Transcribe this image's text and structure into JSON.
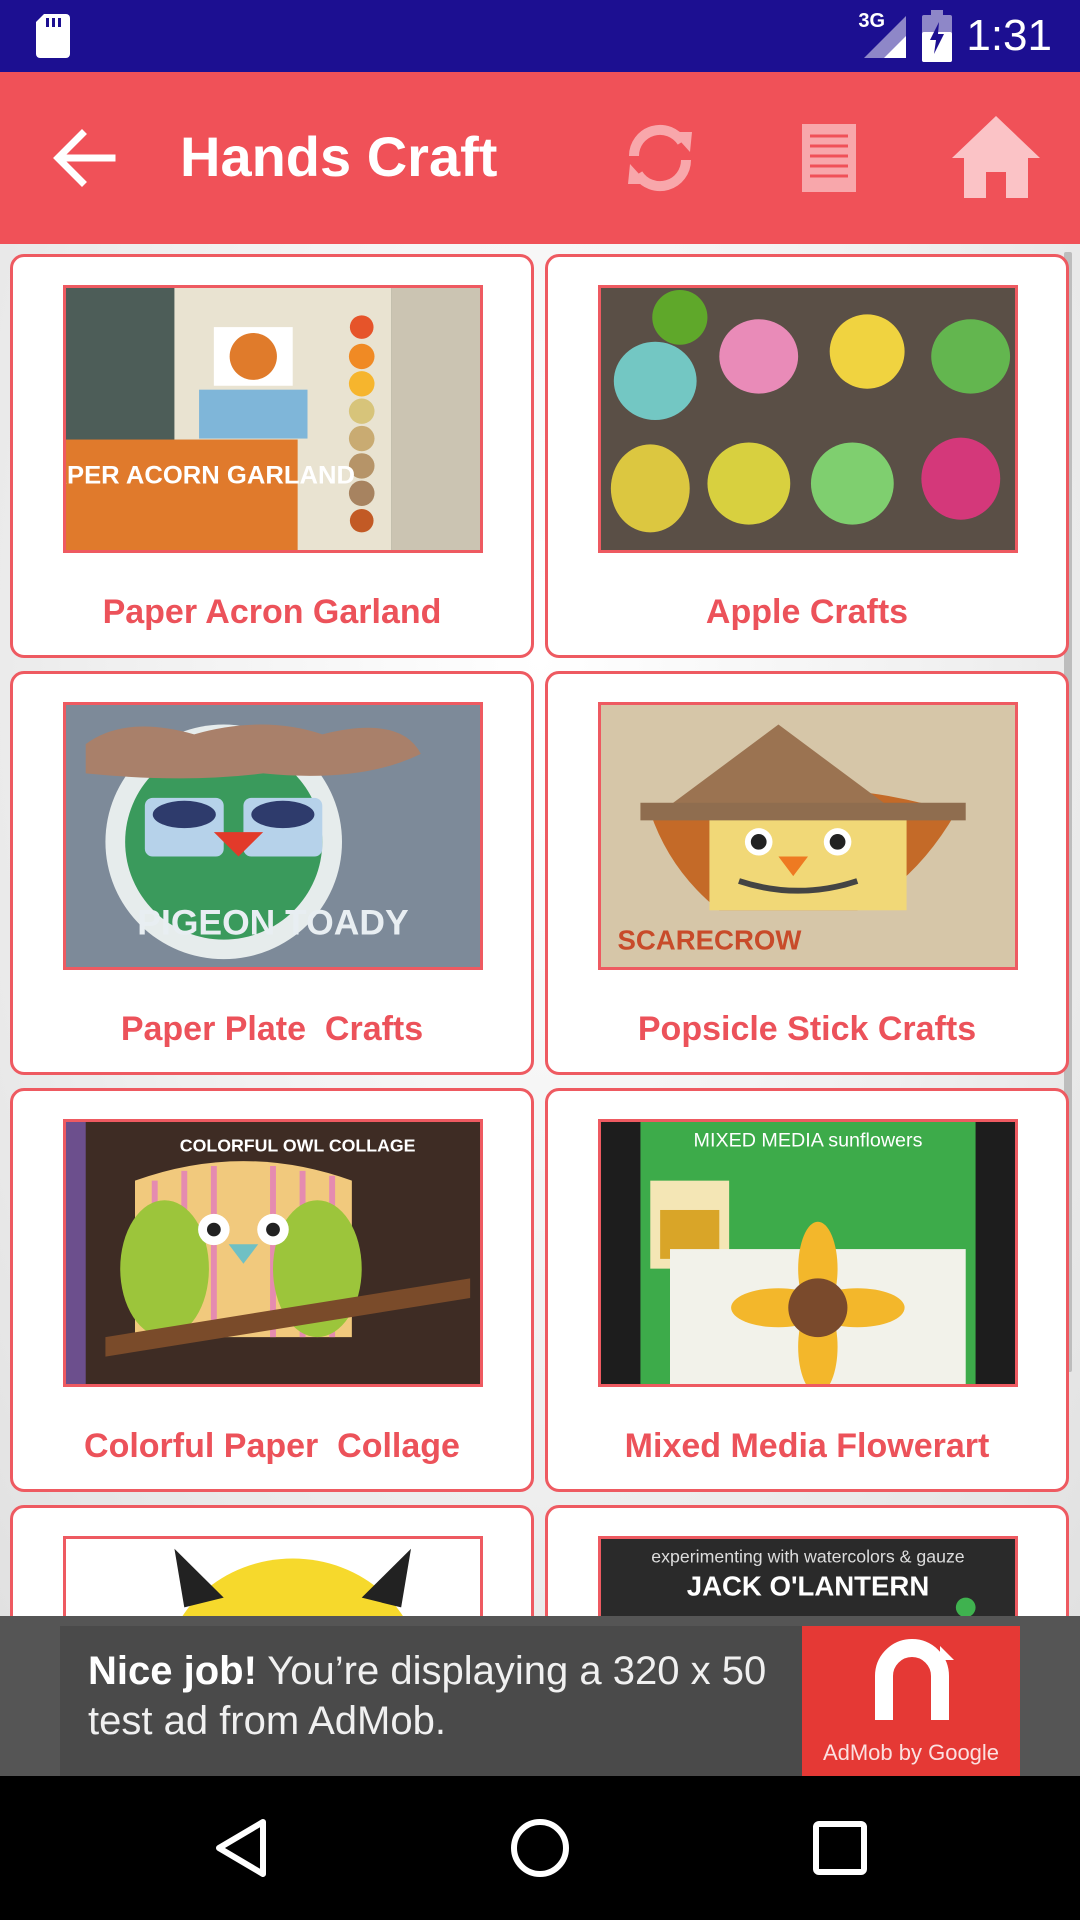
{
  "status_bar": {
    "network": "3G",
    "time": "1:31"
  },
  "app_bar": {
    "title": "Hands Craft",
    "colors": {
      "primary": "#f05158",
      "status": "#1c0f91"
    }
  },
  "cards": [
    {
      "label": "Paper Acron Garland",
      "image_text": "PAPER ACORN GARLAND"
    },
    {
      "label": "Apple Crafts"
    },
    {
      "label": "Paper Plate  Crafts",
      "image_text": "PIGEON TOADY"
    },
    {
      "label": "Popsicle Stick Crafts",
      "image_text": "SCARECROW"
    },
    {
      "label": "Colorful Paper  Collage",
      "image_text": "COLORFUL OWL COLLAGE"
    },
    {
      "label": "Mixed Media Flowerart",
      "image_text": "MIXED MEDIA sunflowers"
    },
    {
      "label": ""
    },
    {
      "label": "",
      "image_text_1": "experimenting with watercolors & gauze",
      "image_text_2": "JACK O'LANTERN"
    }
  ],
  "ad": {
    "bold": "Nice job!",
    "text": " You’re displaying a 320 x 50 test ad from AdMob.",
    "brand": "AdMob by Google"
  }
}
